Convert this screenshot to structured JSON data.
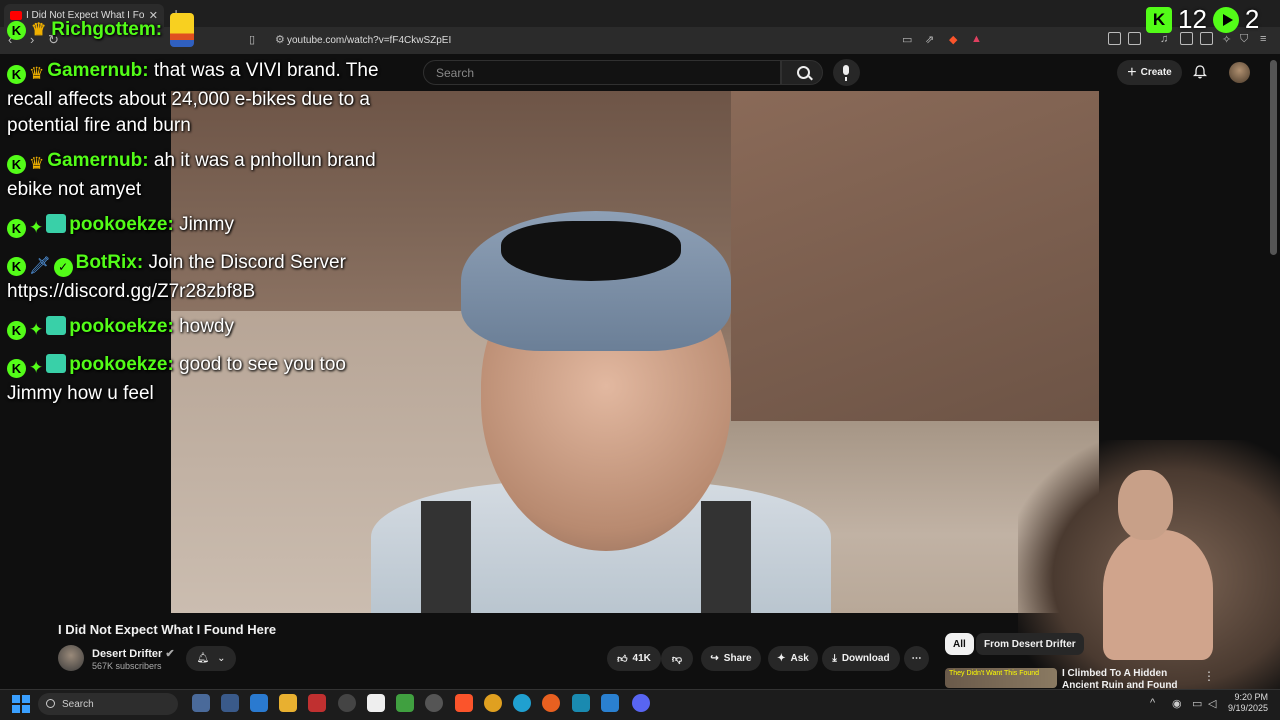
{
  "browser": {
    "tab_title": "I Did Not Expect What I Found Here",
    "url": "youtube.com/watch?v=fF4CkwSZpEI"
  },
  "youtube": {
    "search_placeholder": "Search",
    "create_label": "Create",
    "video_title": "I Did Not Expect What I Found Here",
    "channel_name": "Desert Drifter",
    "subscribers": "567K subscribers",
    "likes": "41K",
    "share_label": "Share",
    "ask_label": "Ask",
    "download_label": "Download",
    "chips": [
      "All",
      "From Desert Drifter"
    ],
    "rec_video_title": "I Climbed To A Hidden Ancient Ruin and Found Something I'v",
    "rec_thumb_text": "They Didn't Want This Found"
  },
  "overlay": {
    "top_user": "Richgottem:",
    "viewers_kick": "12",
    "viewers_other": "2",
    "messages": [
      {
        "user": "Gamernub:",
        "text": "that was a VIVI brand. The recall affects about 24,000 e-bikes due to a potential fire and burn",
        "badges": [
          "kick",
          "crown"
        ]
      },
      {
        "user": "Gamernub:",
        "text": "ah it was a pnhollun brand ebike not amyet",
        "badges": [
          "kick",
          "crown"
        ]
      },
      {
        "user": "pookoekze:",
        "text": "Jimmy",
        "badges": [
          "kick",
          "gem",
          "sub"
        ]
      },
      {
        "user": "BotRix:",
        "text": "Join the Discord Server https://discord.gg/Z7r28zbf8B",
        "badges": [
          "kick",
          "sword",
          "check"
        ]
      },
      {
        "user": "pookoekze:",
        "text": "howdy",
        "badges": [
          "kick",
          "gem",
          "sub"
        ]
      },
      {
        "user": "pookoekze:",
        "text": "good to see you too Jimmy how u feel",
        "badges": [
          "kick",
          "gem",
          "sub"
        ]
      }
    ],
    "user_colors": {
      "gamernub": "#53fc18",
      "pookoekze": "#53fc18",
      "botrix": "#53fc18"
    }
  },
  "taskbar": {
    "search_label": "Search",
    "time": "9:20 PM",
    "date": "9/19/2025"
  }
}
